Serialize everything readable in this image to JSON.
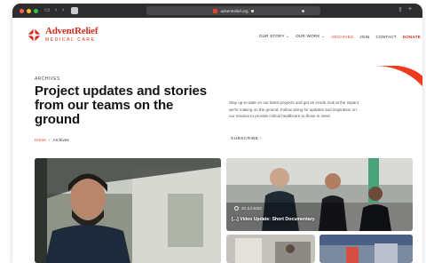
{
  "browser": {
    "url": "adventrelief.org",
    "controls": {
      "sidebar": "▭",
      "back": "‹",
      "forward": "›",
      "share": "⇧",
      "new_tab": "+"
    }
  },
  "brand": {
    "name": "AdventRelief",
    "tagline": "MEDICAL CARE",
    "color": "#d52e1f"
  },
  "nav": {
    "items": [
      "OUR STORY ⌄",
      "OUR WORK ⌄",
      "ARCHIVES",
      "JOIN",
      "CONTACT",
      "DONATE"
    ],
    "active": "ARCHIVES"
  },
  "page": {
    "kicker": "ARCHIVES",
    "title": "Project updates and stories from our teams on the ground",
    "breadcrumb": {
      "home": "Home",
      "separator": "›",
      "current": "Archives"
    },
    "intro": "Stay up-to-date on our latest projects and get an inside look at the impact we're making on the ground. Follow along for updates and inspiration on our mission to provide critical healthcare to those in need.",
    "subscribe": "SUBSCRIBE ›"
  },
  "cards": {
    "featured": {
      "date": "20 Jul 2023",
      "title": "[...] Video Update: Short Documentary"
    }
  },
  "colors": {
    "accent": "#e23a24",
    "chrome": "#2d2d2f"
  }
}
